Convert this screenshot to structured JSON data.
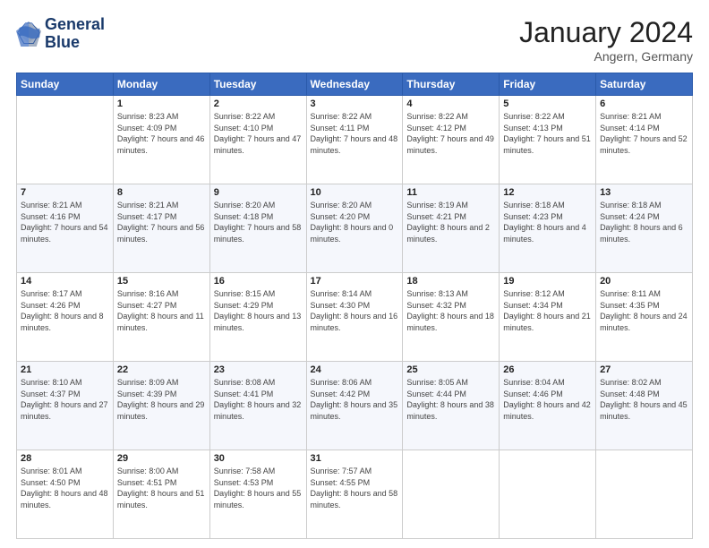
{
  "logo": {
    "line1": "General",
    "line2": "Blue"
  },
  "title": {
    "month": "January 2024",
    "location": "Angern, Germany"
  },
  "days_of_week": [
    "Sunday",
    "Monday",
    "Tuesday",
    "Wednesday",
    "Thursday",
    "Friday",
    "Saturday"
  ],
  "weeks": [
    [
      {
        "day": "",
        "sunrise": "",
        "sunset": "",
        "daylight": ""
      },
      {
        "day": "1",
        "sunrise": "Sunrise: 8:23 AM",
        "sunset": "Sunset: 4:09 PM",
        "daylight": "Daylight: 7 hours and 46 minutes."
      },
      {
        "day": "2",
        "sunrise": "Sunrise: 8:22 AM",
        "sunset": "Sunset: 4:10 PM",
        "daylight": "Daylight: 7 hours and 47 minutes."
      },
      {
        "day": "3",
        "sunrise": "Sunrise: 8:22 AM",
        "sunset": "Sunset: 4:11 PM",
        "daylight": "Daylight: 7 hours and 48 minutes."
      },
      {
        "day": "4",
        "sunrise": "Sunrise: 8:22 AM",
        "sunset": "Sunset: 4:12 PM",
        "daylight": "Daylight: 7 hours and 49 minutes."
      },
      {
        "day": "5",
        "sunrise": "Sunrise: 8:22 AM",
        "sunset": "Sunset: 4:13 PM",
        "daylight": "Daylight: 7 hours and 51 minutes."
      },
      {
        "day": "6",
        "sunrise": "Sunrise: 8:21 AM",
        "sunset": "Sunset: 4:14 PM",
        "daylight": "Daylight: 7 hours and 52 minutes."
      }
    ],
    [
      {
        "day": "7",
        "sunrise": "Sunrise: 8:21 AM",
        "sunset": "Sunset: 4:16 PM",
        "daylight": "Daylight: 7 hours and 54 minutes."
      },
      {
        "day": "8",
        "sunrise": "Sunrise: 8:21 AM",
        "sunset": "Sunset: 4:17 PM",
        "daylight": "Daylight: 7 hours and 56 minutes."
      },
      {
        "day": "9",
        "sunrise": "Sunrise: 8:20 AM",
        "sunset": "Sunset: 4:18 PM",
        "daylight": "Daylight: 7 hours and 58 minutes."
      },
      {
        "day": "10",
        "sunrise": "Sunrise: 8:20 AM",
        "sunset": "Sunset: 4:20 PM",
        "daylight": "Daylight: 8 hours and 0 minutes."
      },
      {
        "day": "11",
        "sunrise": "Sunrise: 8:19 AM",
        "sunset": "Sunset: 4:21 PM",
        "daylight": "Daylight: 8 hours and 2 minutes."
      },
      {
        "day": "12",
        "sunrise": "Sunrise: 8:18 AM",
        "sunset": "Sunset: 4:23 PM",
        "daylight": "Daylight: 8 hours and 4 minutes."
      },
      {
        "day": "13",
        "sunrise": "Sunrise: 8:18 AM",
        "sunset": "Sunset: 4:24 PM",
        "daylight": "Daylight: 8 hours and 6 minutes."
      }
    ],
    [
      {
        "day": "14",
        "sunrise": "Sunrise: 8:17 AM",
        "sunset": "Sunset: 4:26 PM",
        "daylight": "Daylight: 8 hours and 8 minutes."
      },
      {
        "day": "15",
        "sunrise": "Sunrise: 8:16 AM",
        "sunset": "Sunset: 4:27 PM",
        "daylight": "Daylight: 8 hours and 11 minutes."
      },
      {
        "day": "16",
        "sunrise": "Sunrise: 8:15 AM",
        "sunset": "Sunset: 4:29 PM",
        "daylight": "Daylight: 8 hours and 13 minutes."
      },
      {
        "day": "17",
        "sunrise": "Sunrise: 8:14 AM",
        "sunset": "Sunset: 4:30 PM",
        "daylight": "Daylight: 8 hours and 16 minutes."
      },
      {
        "day": "18",
        "sunrise": "Sunrise: 8:13 AM",
        "sunset": "Sunset: 4:32 PM",
        "daylight": "Daylight: 8 hours and 18 minutes."
      },
      {
        "day": "19",
        "sunrise": "Sunrise: 8:12 AM",
        "sunset": "Sunset: 4:34 PM",
        "daylight": "Daylight: 8 hours and 21 minutes."
      },
      {
        "day": "20",
        "sunrise": "Sunrise: 8:11 AM",
        "sunset": "Sunset: 4:35 PM",
        "daylight": "Daylight: 8 hours and 24 minutes."
      }
    ],
    [
      {
        "day": "21",
        "sunrise": "Sunrise: 8:10 AM",
        "sunset": "Sunset: 4:37 PM",
        "daylight": "Daylight: 8 hours and 27 minutes."
      },
      {
        "day": "22",
        "sunrise": "Sunrise: 8:09 AM",
        "sunset": "Sunset: 4:39 PM",
        "daylight": "Daylight: 8 hours and 29 minutes."
      },
      {
        "day": "23",
        "sunrise": "Sunrise: 8:08 AM",
        "sunset": "Sunset: 4:41 PM",
        "daylight": "Daylight: 8 hours and 32 minutes."
      },
      {
        "day": "24",
        "sunrise": "Sunrise: 8:06 AM",
        "sunset": "Sunset: 4:42 PM",
        "daylight": "Daylight: 8 hours and 35 minutes."
      },
      {
        "day": "25",
        "sunrise": "Sunrise: 8:05 AM",
        "sunset": "Sunset: 4:44 PM",
        "daylight": "Daylight: 8 hours and 38 minutes."
      },
      {
        "day": "26",
        "sunrise": "Sunrise: 8:04 AM",
        "sunset": "Sunset: 4:46 PM",
        "daylight": "Daylight: 8 hours and 42 minutes."
      },
      {
        "day": "27",
        "sunrise": "Sunrise: 8:02 AM",
        "sunset": "Sunset: 4:48 PM",
        "daylight": "Daylight: 8 hours and 45 minutes."
      }
    ],
    [
      {
        "day": "28",
        "sunrise": "Sunrise: 8:01 AM",
        "sunset": "Sunset: 4:50 PM",
        "daylight": "Daylight: 8 hours and 48 minutes."
      },
      {
        "day": "29",
        "sunrise": "Sunrise: 8:00 AM",
        "sunset": "Sunset: 4:51 PM",
        "daylight": "Daylight: 8 hours and 51 minutes."
      },
      {
        "day": "30",
        "sunrise": "Sunrise: 7:58 AM",
        "sunset": "Sunset: 4:53 PM",
        "daylight": "Daylight: 8 hours and 55 minutes."
      },
      {
        "day": "31",
        "sunrise": "Sunrise: 7:57 AM",
        "sunset": "Sunset: 4:55 PM",
        "daylight": "Daylight: 8 hours and 58 minutes."
      },
      {
        "day": "",
        "sunrise": "",
        "sunset": "",
        "daylight": ""
      },
      {
        "day": "",
        "sunrise": "",
        "sunset": "",
        "daylight": ""
      },
      {
        "day": "",
        "sunrise": "",
        "sunset": "",
        "daylight": ""
      }
    ]
  ]
}
